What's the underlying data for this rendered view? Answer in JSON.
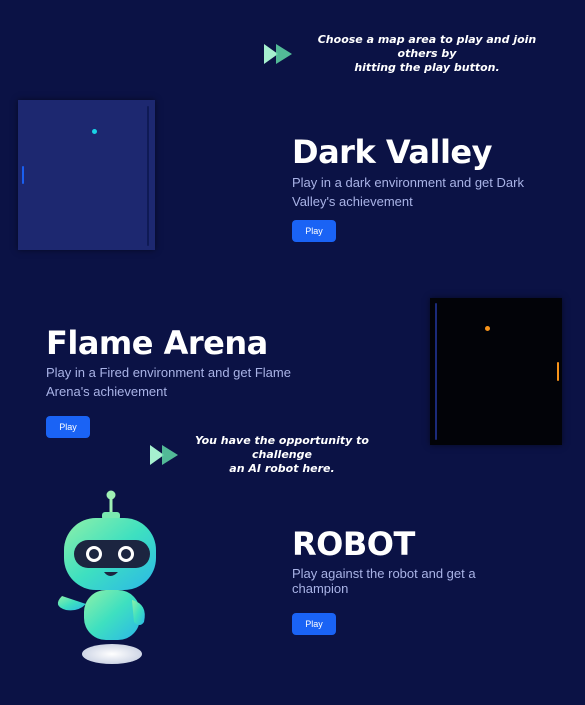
{
  "hints": {
    "map_area": {
      "line1": "Choose a map area to play and join others by",
      "line2": "hitting the play button.",
      "icon": "double-play-arrow-icon"
    },
    "ai_robot": {
      "line1": "You have the opportunity to challenge",
      "line2": "an AI robot here.",
      "icon": "double-play-arrow-icon"
    }
  },
  "sections": {
    "dark_valley": {
      "title": "Dark Valley",
      "desc_line1": "Play in a dark environment and get Dark",
      "desc_line2": "Valley's achievement",
      "play_label": "Play"
    },
    "flame_arena": {
      "title": "Flame Arena",
      "desc_line1": "Play in a Fired environment and get Flame",
      "desc_line2": "Arena's achievement",
      "play_label": "Play"
    },
    "robot": {
      "title": "ROBOT",
      "desc_line1": "Play against the robot and get a",
      "desc_line2": "champion",
      "play_label": "Play"
    }
  },
  "colors": {
    "background": "#0b1245",
    "button": "#1a63f5",
    "description": "#a9b3e6",
    "valley_board": "#1d2870",
    "valley_ball": "#19d3e6",
    "flame_board": "#020308",
    "flame_ball": "#f7931a",
    "robot_body": "#45e0b0"
  }
}
